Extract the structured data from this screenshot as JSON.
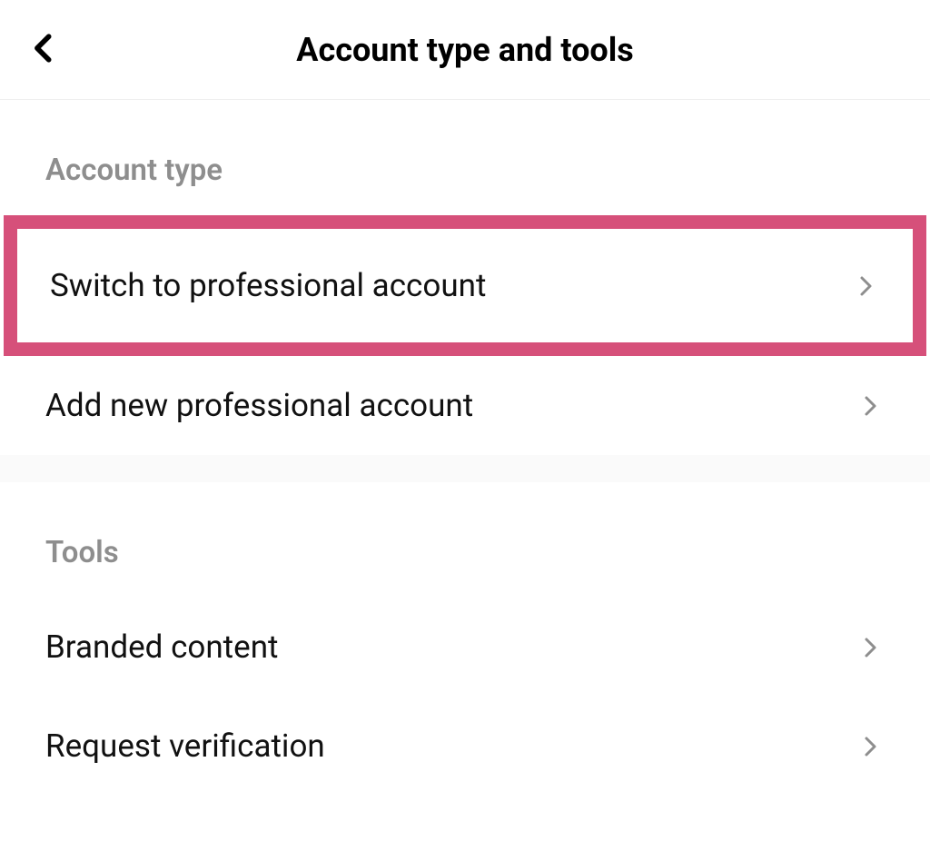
{
  "header": {
    "title": "Account type and tools"
  },
  "sections": {
    "account_type": {
      "header": "Account type",
      "items": [
        {
          "label": "Switch to professional account"
        },
        {
          "label": "Add new professional account"
        }
      ]
    },
    "tools": {
      "header": "Tools",
      "items": [
        {
          "label": "Branded content"
        },
        {
          "label": "Request verification"
        }
      ]
    }
  }
}
